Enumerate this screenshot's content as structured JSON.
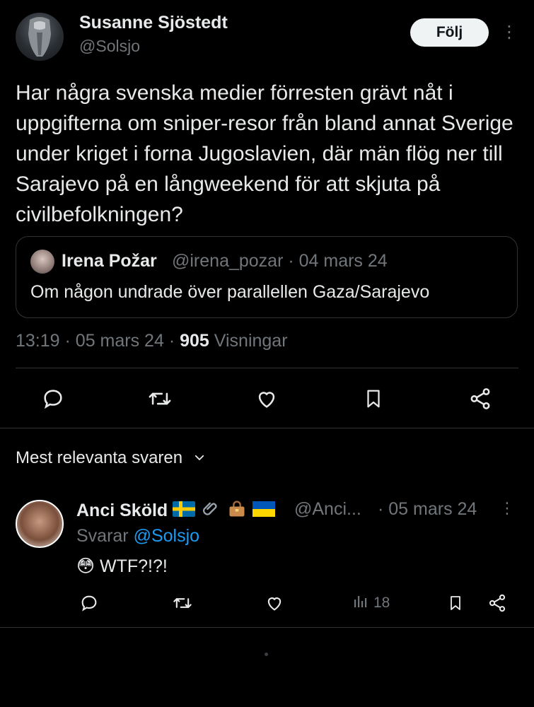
{
  "tweet": {
    "author_name": "Susanne Sjöstedt",
    "author_handle": "@Solsjo",
    "follow_label": "Följ",
    "more_icon": "⋮",
    "text": "Har några svenska medier förresten grävt nåt i uppgifterna om sniper-resor från bland annat Sverige under kriget i forna Jugoslavien, där män flög ner till Sarajevo på en långweekend för att skjuta på civilbefolkningen?",
    "time": "13:19",
    "date": "05 mars 24",
    "views_count": "905",
    "views_label": "Visningar"
  },
  "quote": {
    "author_name": "Irena Požar",
    "meta": "@irena_pozar · 04 mars 24",
    "text": "Om någon undrade över parallellen Gaza/Sarajevo"
  },
  "actions": {
    "icons": [
      "reply-icon",
      "retweet-icon",
      "like-icon",
      "bookmark-icon",
      "share-icon"
    ]
  },
  "replies_sort": {
    "label": "Mest relevanta svaren",
    "chevron": "⌄"
  },
  "reply": {
    "author_name": "Anci Sköld",
    "handle": "@Anci...",
    "date": "· 05 mars 24",
    "more_icon": "⋮",
    "replying_prefix": "Svarar",
    "replying_to": "@Solsjo",
    "emoji": "😳",
    "text": "WTF?!?!",
    "views_count": "18"
  },
  "colors": {
    "background": "#000000",
    "text": "#e7e9ea",
    "muted": "#71767b",
    "link": "#1d9bf0",
    "divider": "#2f3336",
    "follow_bg": "#eff3f4"
  }
}
